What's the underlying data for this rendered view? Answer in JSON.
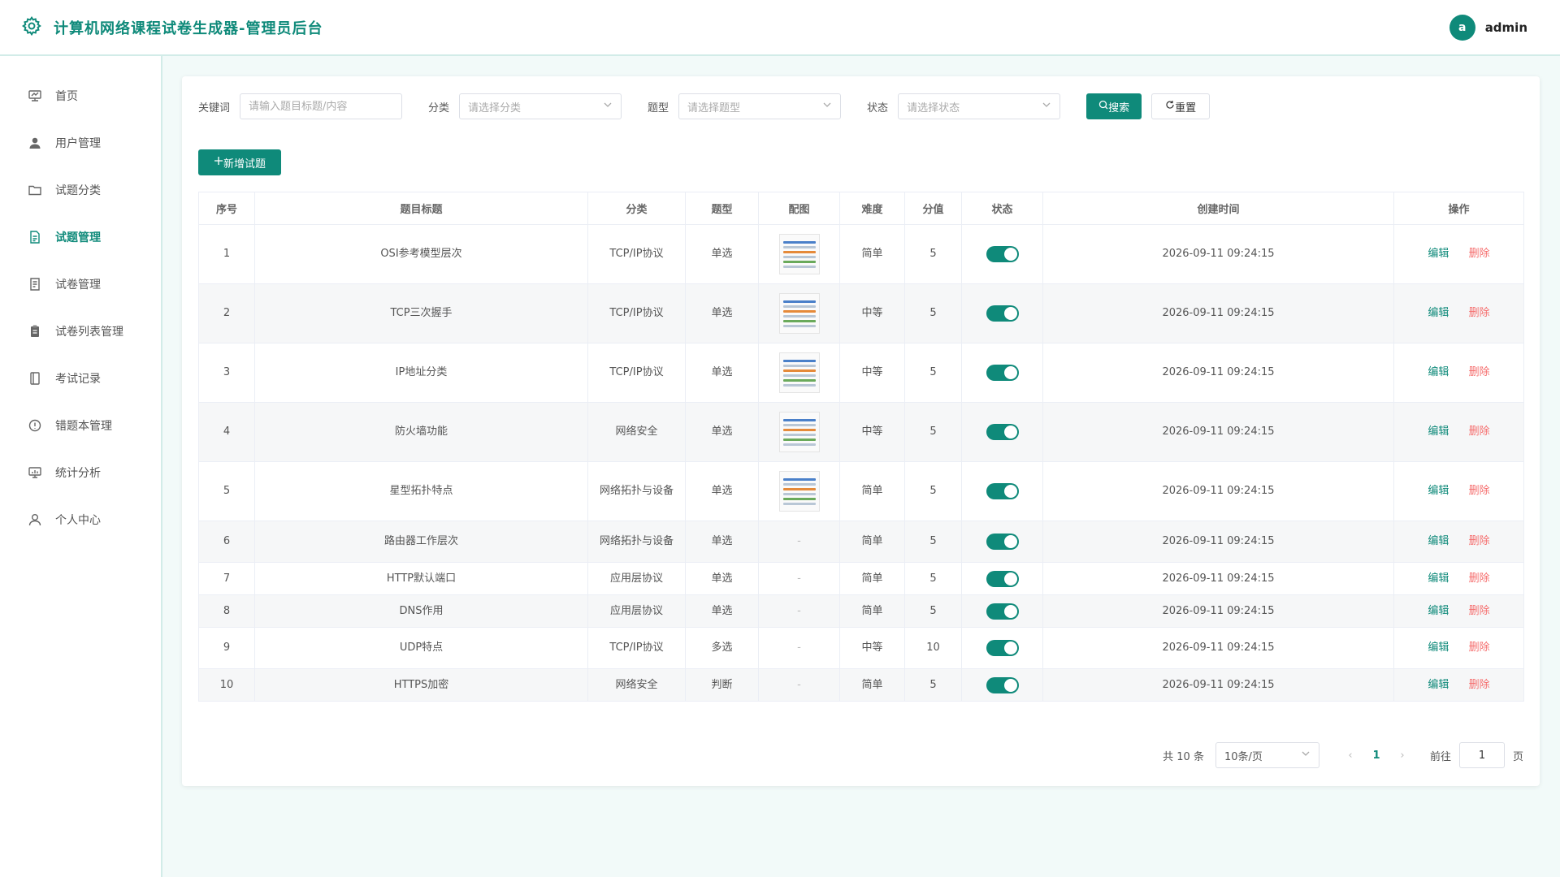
{
  "header": {
    "title": "计算机网络课程试卷生成器-管理员后台",
    "avatar_letter": "a",
    "username": "admin",
    "accent": "#0f8a7a"
  },
  "sidebar": {
    "items": [
      {
        "label": "首页",
        "icon": "monitor-icon",
        "active": false
      },
      {
        "label": "用户管理",
        "icon": "user-icon",
        "active": false
      },
      {
        "label": "试题分类",
        "icon": "folder-icon",
        "active": false
      },
      {
        "label": "试题管理",
        "icon": "document-icon",
        "active": true
      },
      {
        "label": "试卷管理",
        "icon": "file-icon",
        "active": false
      },
      {
        "label": "试卷列表管理",
        "icon": "clipboard-icon",
        "active": false
      },
      {
        "label": "考试记录",
        "icon": "notebook-icon",
        "active": false
      },
      {
        "label": "错题本管理",
        "icon": "warning-icon",
        "active": false
      },
      {
        "label": "统计分析",
        "icon": "chart-icon",
        "active": false
      },
      {
        "label": "个人中心",
        "icon": "person-icon",
        "active": false
      }
    ]
  },
  "filters": {
    "keyword_label": "关键词",
    "keyword_placeholder": "请输入题目标题/内容",
    "category_label": "分类",
    "category_placeholder": "请选择分类",
    "type_label": "题型",
    "type_placeholder": "请选择题型",
    "status_label": "状态",
    "status_placeholder": "请选择状态",
    "search_label": "搜索",
    "reset_label": "重置"
  },
  "toolbar": {
    "add_label": "新增试题"
  },
  "table": {
    "headers": [
      "序号",
      "题目标题",
      "分类",
      "题型",
      "配图",
      "难度",
      "分值",
      "状态",
      "创建时间",
      "操作"
    ],
    "edit_label": "编辑",
    "delete_label": "删除",
    "rows": [
      {
        "no": "1",
        "title": "OSI参考模型层次",
        "category": "TCP/IP协议",
        "type": "单选",
        "image": true,
        "difficulty": "简单",
        "score": "5",
        "enabled": true,
        "created": "2026-09-11 09:24:15"
      },
      {
        "no": "2",
        "title": "TCP三次握手",
        "category": "TCP/IP协议",
        "type": "单选",
        "image": true,
        "difficulty": "中等",
        "score": "5",
        "enabled": true,
        "created": "2026-09-11 09:24:15"
      },
      {
        "no": "3",
        "title": "IP地址分类",
        "category": "TCP/IP协议",
        "type": "单选",
        "image": true,
        "difficulty": "中等",
        "score": "5",
        "enabled": true,
        "created": "2026-09-11 09:24:15"
      },
      {
        "no": "4",
        "title": "防火墙功能",
        "category": "网络安全",
        "type": "单选",
        "image": true,
        "difficulty": "中等",
        "score": "5",
        "enabled": true,
        "created": "2026-09-11 09:24:15"
      },
      {
        "no": "5",
        "title": "星型拓扑特点",
        "category": "网络拓扑与设备",
        "type": "单选",
        "image": true,
        "difficulty": "简单",
        "score": "5",
        "enabled": true,
        "created": "2026-09-11 09:24:15"
      },
      {
        "no": "6",
        "title": "路由器工作层次",
        "category": "网络拓扑与设备",
        "type": "单选",
        "image": false,
        "difficulty": "简单",
        "score": "5",
        "enabled": true,
        "created": "2026-09-11 09:24:15"
      },
      {
        "no": "7",
        "title": "HTTP默认端口",
        "category": "应用层协议",
        "type": "单选",
        "image": false,
        "difficulty": "简单",
        "score": "5",
        "enabled": true,
        "created": "2026-09-11 09:24:15"
      },
      {
        "no": "8",
        "title": "DNS作用",
        "category": "应用层协议",
        "type": "单选",
        "image": false,
        "difficulty": "简单",
        "score": "5",
        "enabled": true,
        "created": "2026-09-11 09:24:15"
      },
      {
        "no": "9",
        "title": "UDP特点",
        "category": "TCP/IP协议",
        "type": "多选",
        "image": false,
        "difficulty": "中等",
        "score": "10",
        "enabled": true,
        "created": "2026-09-11 09:24:15"
      },
      {
        "no": "10",
        "title": "HTTPS加密",
        "category": "网络安全",
        "type": "判断",
        "image": false,
        "difficulty": "简单",
        "score": "5",
        "enabled": true,
        "created": "2026-09-11 09:24:15"
      }
    ],
    "no_image_text": "-"
  },
  "pagination": {
    "total_text": "共 10 条",
    "page_size": "10条/页",
    "current_page": "1",
    "goto_label": "前往",
    "goto_value": "1",
    "page_suffix": "页"
  }
}
